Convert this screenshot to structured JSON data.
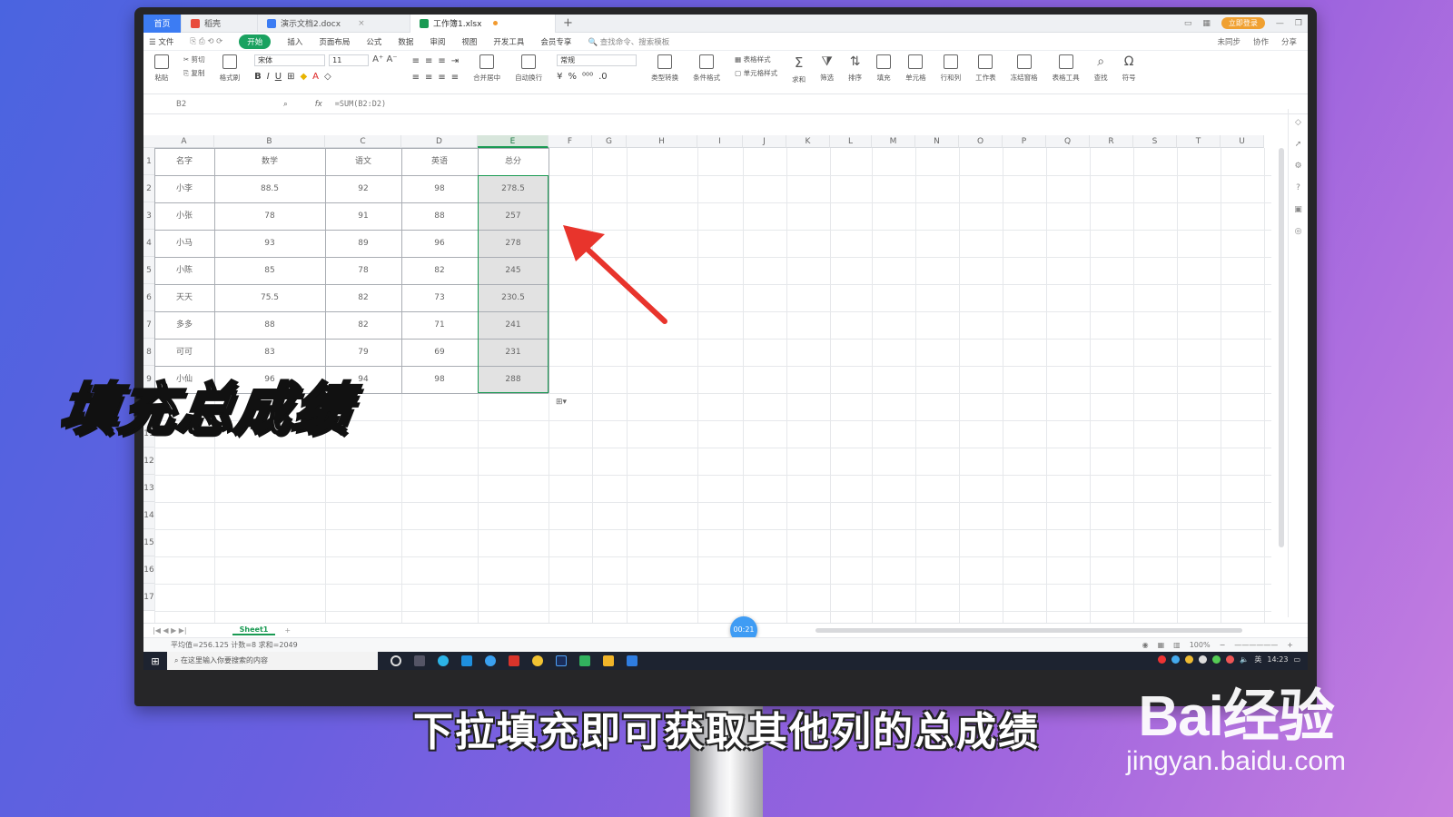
{
  "tabs": [
    {
      "label": "首页",
      "kind": "home"
    },
    {
      "label": "稻壳",
      "kind": "docer"
    },
    {
      "label": "演示文档2.docx",
      "kind": "doc"
    },
    {
      "label": "工作簿1.xlsx",
      "kind": "sheet"
    }
  ],
  "member_label": "立即登录",
  "menu": {
    "items": [
      "文件",
      "开始",
      "插入",
      "页面布局",
      "公式",
      "数据",
      "审阅",
      "视图",
      "开发工具",
      "会员专享"
    ],
    "search": "查找命令、搜索模板",
    "right": [
      "未同步",
      "协作",
      "分享"
    ]
  },
  "toolbar": {
    "paste": "粘贴",
    "cut": "剪切",
    "copy": "复制",
    "format_painter": "格式刷",
    "font": "宋体",
    "size": "11",
    "number_format": "常规",
    "merge": "合并居中",
    "wrap": "自动换行",
    "convert": "类型转换",
    "cond_format": "条件格式",
    "table_style": "表格样式",
    "cell_style": "单元格样式",
    "sum": "求和",
    "filter": "筛选",
    "sort": "排序",
    "fill": "填充",
    "cell": "单元格",
    "rowcol": "行和列",
    "worksheet": "工作表",
    "freeze": "冻结窗格",
    "table_tools": "表格工具",
    "find": "查找",
    "symbol": "符号"
  },
  "formula_bar": {
    "cell_ref": "B2",
    "formula": "=SUM(B2:D2)"
  },
  "columns": [
    "A",
    "B",
    "C",
    "D",
    "E",
    "F",
    "G",
    "H",
    "I",
    "J",
    "K",
    "L",
    "M",
    "N",
    "O",
    "P",
    "Q",
    "R",
    "S",
    "T",
    "U"
  ],
  "rows": [
    "1",
    "2",
    "3",
    "4",
    "5",
    "6",
    "7",
    "8",
    "9",
    "10",
    "11",
    "12",
    "13",
    "14",
    "15",
    "16",
    "17"
  ],
  "table": {
    "headers": [
      "名字",
      "数学",
      "语文",
      "英语",
      "总分"
    ],
    "rows": [
      [
        "小李",
        "88.5",
        "92",
        "98",
        "278.5"
      ],
      [
        "小张",
        "78",
        "91",
        "88",
        "257"
      ],
      [
        "小马",
        "93",
        "89",
        "96",
        "278"
      ],
      [
        "小陈",
        "85",
        "78",
        "82",
        "245"
      ],
      [
        "天天",
        "75.5",
        "82",
        "73",
        "230.5"
      ],
      [
        "多多",
        "88",
        "82",
        "71",
        "241"
      ],
      [
        "可可",
        "83",
        "79",
        "69",
        "231"
      ],
      [
        "小仙",
        "96",
        "94",
        "98",
        "288"
      ]
    ]
  },
  "sheet_tab": "Sheet1",
  "status": "平均值=256.125  计数=8  求和=2049",
  "zoom": "100%",
  "timer": "00:21",
  "taskbar_search": "在这里输入你要搜索的内容",
  "clock": "14:23",
  "overlay_title": "填充总成绩",
  "subtitle": "下拉填充即可获取其他列的总成绩",
  "watermark": {
    "logo": "Bai经验",
    "url": "jingyan.baidu.com"
  },
  "colors": {
    "accent_green": "#1a9a53",
    "arrow_red": "#e8342c",
    "wps_blue": "#3c7cf3"
  }
}
